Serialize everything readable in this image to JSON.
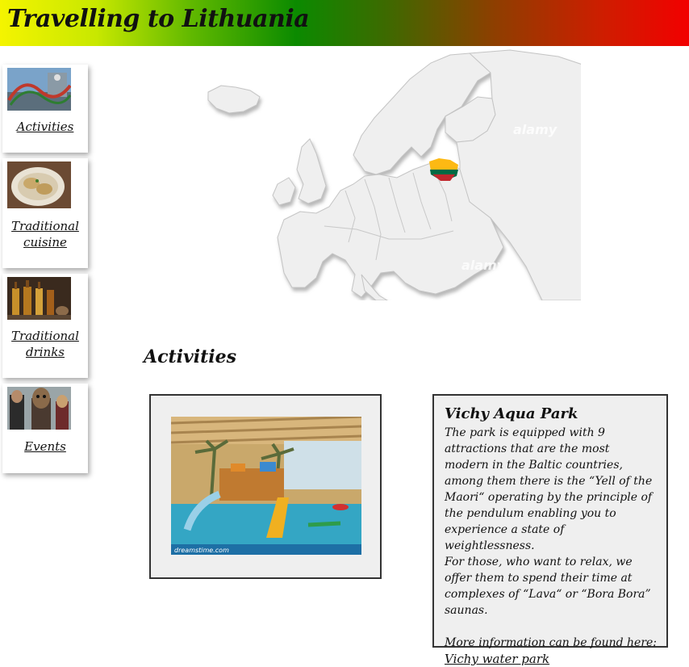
{
  "header": {
    "title": "Travelling to Lithuania"
  },
  "sidebar": {
    "items": [
      {
        "label": "Activities",
        "icon": "water-slide-photo"
      },
      {
        "label": "Traditional cuisine",
        "icon": "dumplings-photo"
      },
      {
        "label": "Traditional drinks",
        "icon": "bottles-photo"
      },
      {
        "label": "Events",
        "icon": "masks-photo"
      }
    ]
  },
  "map": {
    "watermark": "alamy"
  },
  "main": {
    "section_title": "Activities",
    "photo": {
      "watermark": "dreamstime.com"
    },
    "info": {
      "title": "Vichy Aqua Park",
      "body_1": "The park is equipped with 9 attractions that are the most modern in the Baltic countries, among them there is the “Yell of the Maori“ operating by the principle of the pendulum enabling you to experience a state of weightlessness.",
      "body_2": "For those, who want to relax, we offer them to spend their time at complexes of “Lava“ or “Bora Bora” saunas.",
      "more_text": "More information can be found here:",
      "link_label": "Vichy water park"
    }
  },
  "colors": {
    "banner_gradient": [
      "#f4f400",
      "#0b8a00",
      "#f20000"
    ],
    "flag": [
      "#fdb913",
      "#006a44",
      "#c1272d"
    ]
  }
}
